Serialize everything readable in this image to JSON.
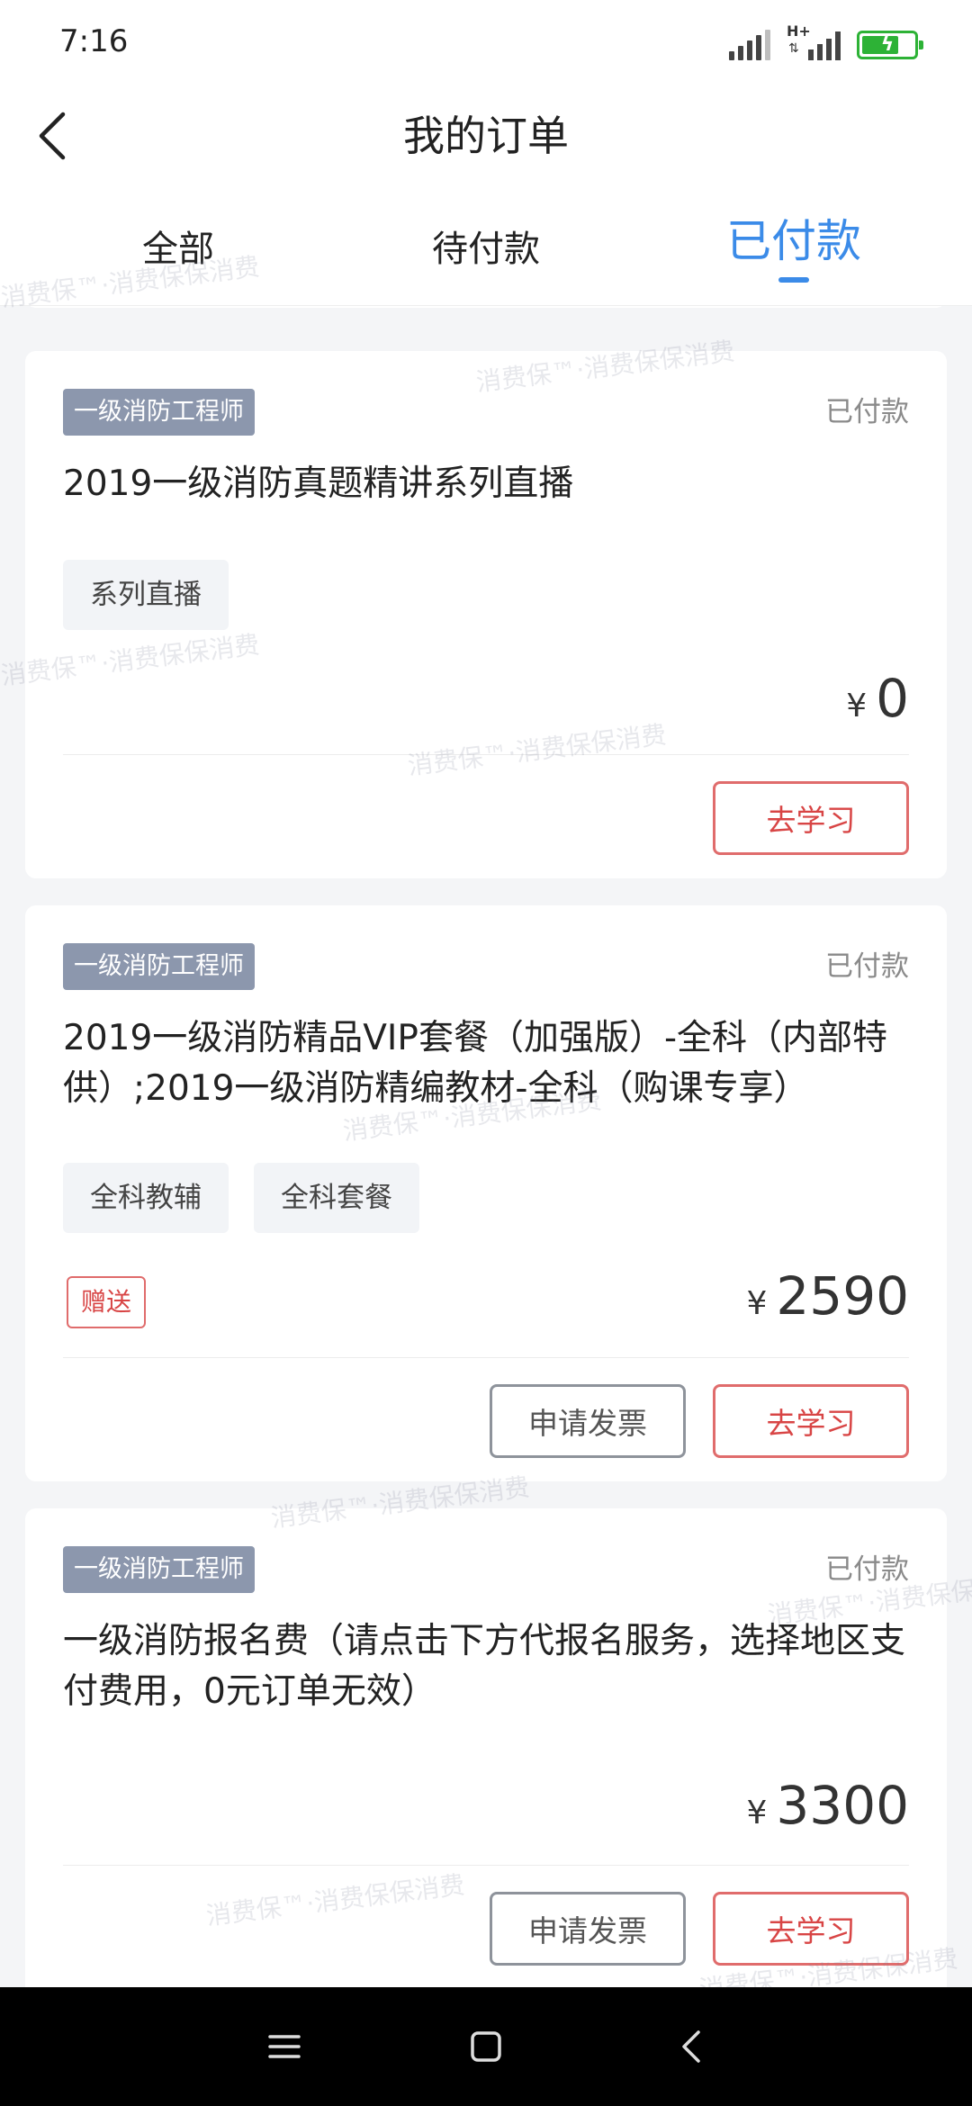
{
  "status_bar": {
    "time": "7:16",
    "network_label": "H+"
  },
  "header": {
    "title": "我的订单"
  },
  "tabs": [
    {
      "label": "全部"
    },
    {
      "label": "待付款"
    },
    {
      "label": "已付款"
    }
  ],
  "active_tab": "已付款",
  "orders": [
    {
      "category": "一级消防工程师",
      "status": "已付款",
      "title": "2019一级消防真题精讲系列直播",
      "tags": [
        "系列直播"
      ],
      "gift": "",
      "currency": "¥",
      "price": "0",
      "buttons": {
        "study": "去学习"
      }
    },
    {
      "category": "一级消防工程师",
      "status": "已付款",
      "title": "2019一级消防精品VIP套餐（加强版）-全科（内部特供）;2019一级消防精编教材-全科（购课专享）",
      "tags": [
        "全科教辅",
        "全科套餐"
      ],
      "gift": "赠送",
      "currency": "¥",
      "price": "2590",
      "buttons": {
        "invoice": "申请发票",
        "study": "去学习"
      }
    },
    {
      "category": "一级消防工程师",
      "status": "已付款",
      "title": "一级消防报名费（请点击下方代报名服务，选择地区支付费用，0元订单无效）",
      "tags": [],
      "gift": "",
      "currency": "¥",
      "price": "3300",
      "buttons": {
        "invoice": "申请发票",
        "study": "去学习"
      }
    }
  ],
  "watermark_text": "消费保™·消费保保消费",
  "colors": {
    "accent": "#3b8be8",
    "category_badge": "#8c97ad",
    "study_button": "#e06c6c",
    "battery": "#2db236"
  },
  "icons": {
    "back": "chevron-left-icon",
    "menu": "menu-icon",
    "home": "square-home-icon",
    "nav_back": "triangle-back-icon"
  }
}
